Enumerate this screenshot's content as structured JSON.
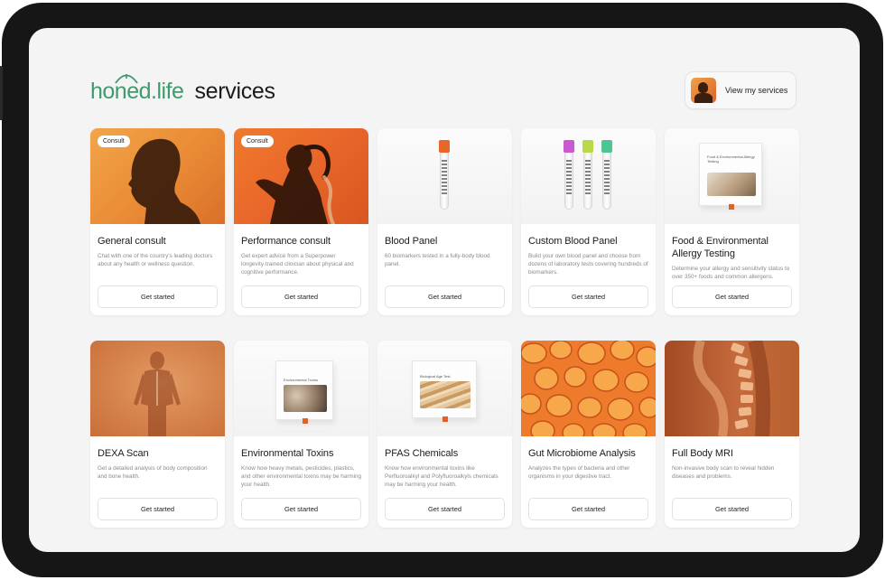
{
  "brand": {
    "logo": "honed.life",
    "heading": "services"
  },
  "header": {
    "my_services_label": "View my services"
  },
  "colors": {
    "brand_green": "#3f9a6e",
    "accent_orange": "#e8662a"
  },
  "cards": [
    {
      "badge": "Consult",
      "title": "General consult",
      "description": "Chat with one of the country's leading doctors about any health or wellness question.",
      "button": "Get started",
      "thumbnail": "silhouette-head"
    },
    {
      "badge": "Consult",
      "title": "Performance consult",
      "description": "Get expert advice from a Superpower longevity-trained clinician about physical and cognitive performance.",
      "button": "Get started",
      "thumbnail": "silhouette-runner"
    },
    {
      "title": "Blood Panel",
      "description": "60 biomarkers tested in a fully-body blood panel.",
      "button": "Get started",
      "thumbnail": "blood-tube"
    },
    {
      "title": "Custom Blood Panel",
      "description": "Build your own blood panel and choose from dozens of laboratory tests covering hundreds of biomarkers.",
      "button": "Get started",
      "thumbnail": "blood-tubes"
    },
    {
      "title": "Food & Environmental Allergy Testing",
      "description": "Determine your allergy and sensitivity status to over 350+ foods and common allergens.",
      "button": "Get started",
      "thumbnail": "test-box",
      "box_label": "Food & Environmental Allergy Testing"
    },
    {
      "title": "DEXA Scan",
      "description": "Get a detailed analysis of body composition and bone health.",
      "button": "Get started",
      "thumbnail": "dexa-body"
    },
    {
      "title": "Environmental Toxins",
      "description": "Know how heavy metals, pesticides, plastics, and other environmental toxins may be harming your health.",
      "button": "Get started",
      "thumbnail": "test-box",
      "box_label": "Environmental Toxins"
    },
    {
      "title": "PFAS Chemicals",
      "description": "Know how environmental toxins like Perfluoroalkyl and Polyfluoroalkyls chemicals may be harming your health.",
      "button": "Get started",
      "thumbnail": "test-box",
      "box_label": "Biological Age Test"
    },
    {
      "title": "Gut Microbiome Analysis",
      "description": "Analyzes the types of bacteria and other organisms in your digestive tract.",
      "button": "Get started",
      "thumbnail": "microbiome"
    },
    {
      "title": "Full Body MRI",
      "description": "Non-invasive body scan to reveal hidden diseases and problems.",
      "button": "Get started",
      "thumbnail": "mri-spine"
    }
  ]
}
